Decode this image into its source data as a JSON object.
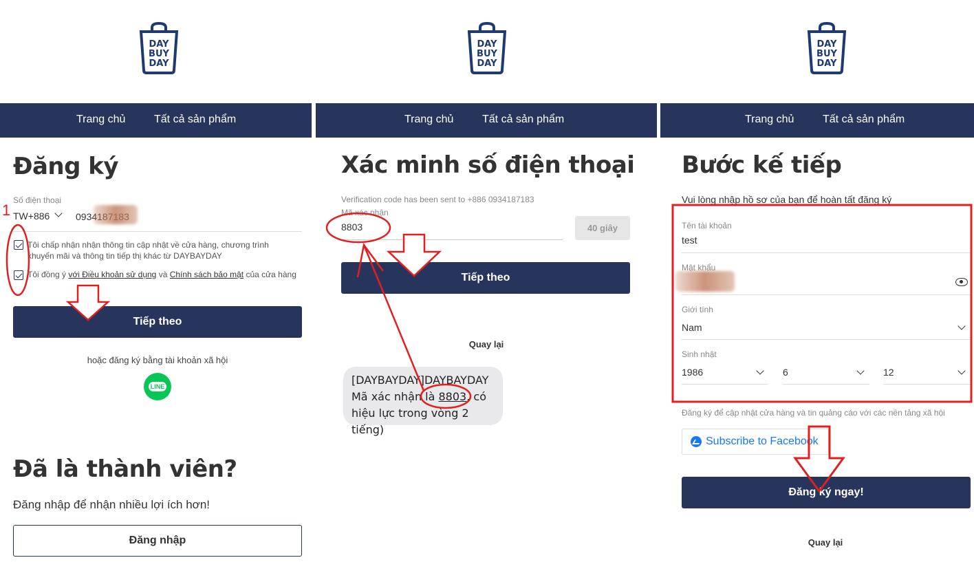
{
  "brand": {
    "logo_lines": [
      "DAY",
      "BUY",
      "DAY"
    ]
  },
  "nav": {
    "home": "Trang chủ",
    "all_products": "Tất cả sản phẩm"
  },
  "register": {
    "title": "Đăng ký",
    "phone_label": "Số điện thoại",
    "country_code": "TW+886",
    "phone_value": "0934187183",
    "consent_marketing": "Tôi chấp nhận nhận thông tin cập nhật về cửa hàng, chương trình khuyến mãi và thông tin tiếp thị khác từ DAYBAYDAY",
    "consent_terms_prefix": "Tôi đồng ý ",
    "terms_link": "với Điều khoản sử dụng",
    "consent_terms_and": " và ",
    "privacy_link": "Chính sách bảo mật",
    "consent_terms_suffix": " của cửa hàng",
    "next_button": "Tiếp theo",
    "social_text": "hoặc đăng ký bằng tài khoản xã hội",
    "line_icon_label": "LINE",
    "member_title": "Đã là thành viên?",
    "member_text": "Đăng nhập để nhận nhiều lợi ích hơn!",
    "login_button": "Đăng nhập"
  },
  "verify": {
    "title": "Xác minh số điện thoại",
    "sent_text": "Verification code has been sent to +886 0934187183",
    "code_label": "Mã xác nhận",
    "code_value": "8803",
    "timer_button": "40 giây",
    "next_button": "Tiếp theo",
    "back_link": "Quay lại",
    "sms_line1": "[DAYBAYDAY]DAYBAYDAY",
    "sms_line2_prefix": "Mã xác nhận là ",
    "sms_code": "8803",
    "sms_line2_suffix": ". có",
    "sms_line3": "hiệu lực trong vòng 2 tiếng)"
  },
  "profile": {
    "title": "Bước kế tiếp",
    "subtitle": "Vui lòng nhập hồ sơ của bạn để hoàn tất đăng ký",
    "username_label": "Tên tài khoản",
    "username_value": "test",
    "password_label": "Mật khẩu",
    "gender_label": "Giới tính",
    "gender_value": "Nam",
    "birthday_label": "Sinh nhật",
    "birth_year": "1986",
    "birth_month": "6",
    "birth_day": "12",
    "social_text": "Đăng ký để cập nhật cửa hàng và tin quảng cáo với các nền tảng xã hội",
    "facebook_button": "Subscribe to Facebook",
    "submit_button": "Đăng ký ngay!",
    "back_link": "Quay lại"
  },
  "annotations": {
    "step_number": "1",
    "annotation_color": "#e02020"
  }
}
